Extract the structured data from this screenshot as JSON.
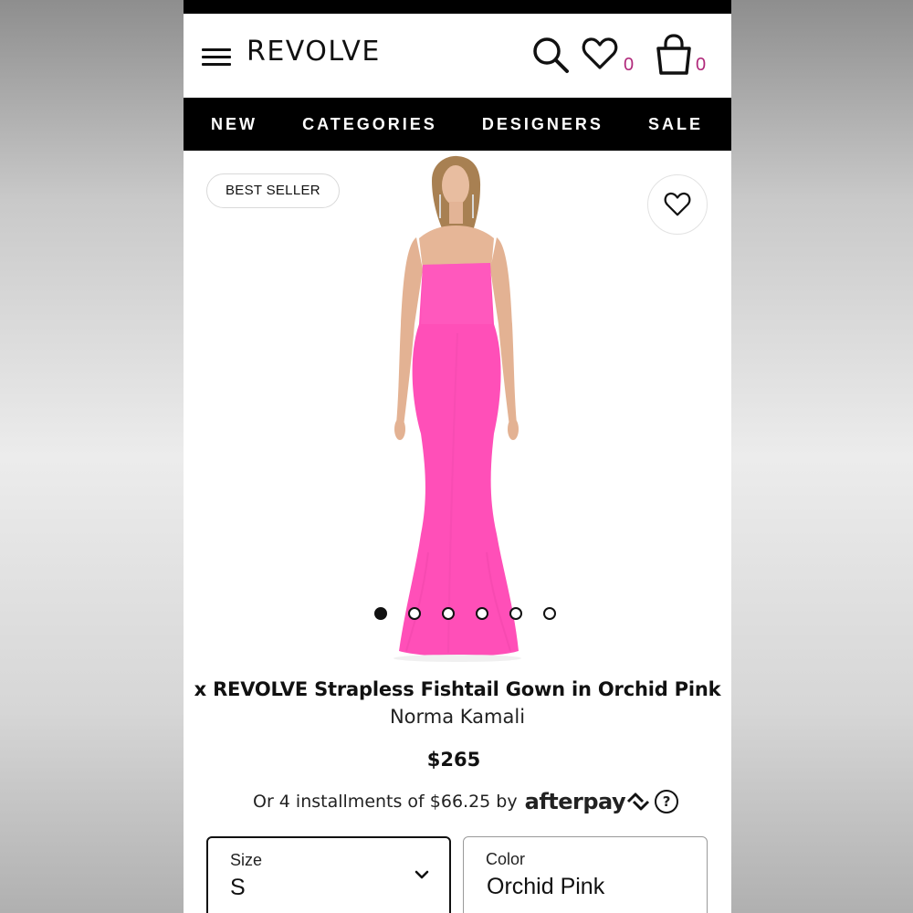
{
  "header": {
    "brand": "REVOLVE",
    "wishlist_count": "0",
    "cart_count": "0"
  },
  "nav": {
    "items": [
      {
        "label": "NEW"
      },
      {
        "label": "CATEGORIES"
      },
      {
        "label": "DESIGNERS"
      },
      {
        "label": "SALE"
      }
    ]
  },
  "gallery": {
    "badge": "BEST SELLER",
    "image_count": 6,
    "active_image": 1,
    "dress_color": "#ff4fb8"
  },
  "product": {
    "title": "x REVOLVE Strapless Fishtail Gown in Orchid Pink",
    "designer": "Norma Kamali",
    "price": "$265",
    "installments_text": "Or 4 installments of $66.25 by",
    "afterpay_brand": "afterpay",
    "help_symbol": "?"
  },
  "options": {
    "size_label": "Size",
    "size_value": "S",
    "color_label": "Color",
    "color_value": "Orchid Pink"
  },
  "icons": [
    "menu-icon",
    "search-icon",
    "heart-icon",
    "shopping-bag-icon",
    "chevron-down-icon",
    "afterpay-logo-icon"
  ]
}
